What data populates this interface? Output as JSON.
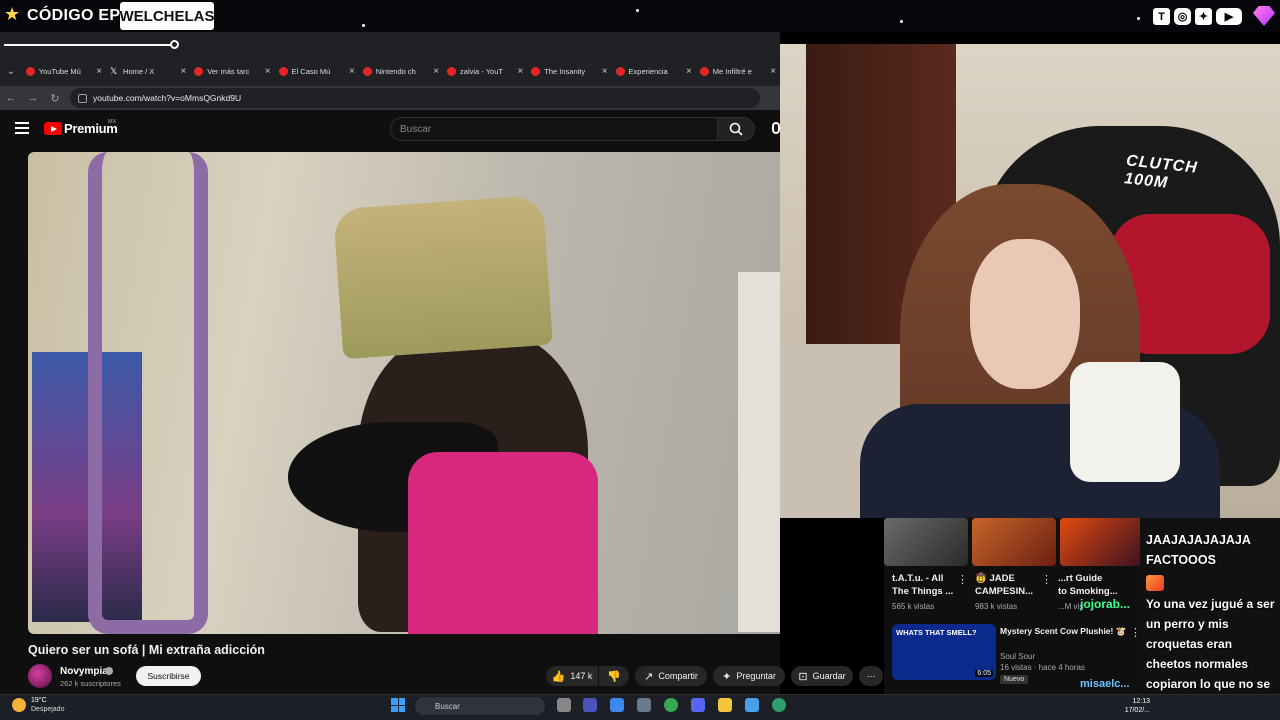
{
  "overlay": {
    "code_label": "CÓDIGO EPIC",
    "code_value": "WELCHELAS",
    "social_icons": [
      "twitch-icon",
      "instagram-icon",
      "twitter-icon",
      "youtube-icon",
      "gem-icon"
    ]
  },
  "browser": {
    "tabs": [
      {
        "label": "YouTube Mú",
        "icon": "youtube-icon"
      },
      {
        "label": "Home / X",
        "icon": "x-icon"
      },
      {
        "label": "Ver más tarc",
        "icon": "youtube-icon"
      },
      {
        "label": "El Caso Mú",
        "icon": "youtube-icon"
      },
      {
        "label": "Nintendo ch",
        "icon": "youtube-icon"
      },
      {
        "label": "zalvia - YouT",
        "icon": "youtube-icon"
      },
      {
        "label": "The Insanity",
        "icon": "youtube-icon"
      },
      {
        "label": "Experiencia",
        "icon": "youtube-icon"
      },
      {
        "label": "Me Infiltré e",
        "icon": "youtube-icon"
      }
    ],
    "url": "youtube.com/watch?v=oMmsQGnkd9U"
  },
  "youtube": {
    "brand": "Premium",
    "region": "MX",
    "search_placeholder": "Buscar",
    "video_title": "Quiero ser un sofá | Mi extraña adicción",
    "channel": {
      "name": "Novympia",
      "subscribers": "262 k suscriptores"
    },
    "subscribe_label": "Suscribirse",
    "actions": {
      "likes": "147 k",
      "share": "Compartir",
      "ask": "Preguntar",
      "save": "Guardar"
    },
    "related": [
      {
        "title_line1": "t.A.T.u. - All",
        "title_line2": "The Things ...",
        "meta": "565 k vistas"
      },
      {
        "title_line1": "🤠 JADE",
        "title_line2": "CAMPESIN...",
        "meta": "983 k vistas"
      },
      {
        "title_line1": "...rt Guide",
        "title_line2": "to Smoking...",
        "meta": "...M vis"
      }
    ],
    "related_main": {
      "thumb_text": "WHATS THAT SMELL?",
      "duration": "6:05",
      "title": "Mystery Scent Cow Plushie! 🐮",
      "channel": "Soul Sour",
      "meta": "16 vistas · hace 4 horas",
      "badge": "Nuevo"
    }
  },
  "webcam": {
    "chair_brand_line1": "CLUTCH",
    "chair_brand_line2": "100M"
  },
  "chat": {
    "messages": [
      {
        "text": "JAAJAJAJAJAJA FACTOOOS"
      },
      {
        "text": "Yo una vez jugué a ser un perro y mis croquetas eran cheetos normales copiaron lo que no se tenía que copiar"
      }
    ],
    "user1": "jojorab...",
    "user2": "misaelc..."
  },
  "taskbar": {
    "weather_temp": "19°C",
    "weather_desc": "Despejado",
    "search_placeholder": "Buscar",
    "clock_time": "12:13",
    "clock_date": "17/02/..."
  }
}
